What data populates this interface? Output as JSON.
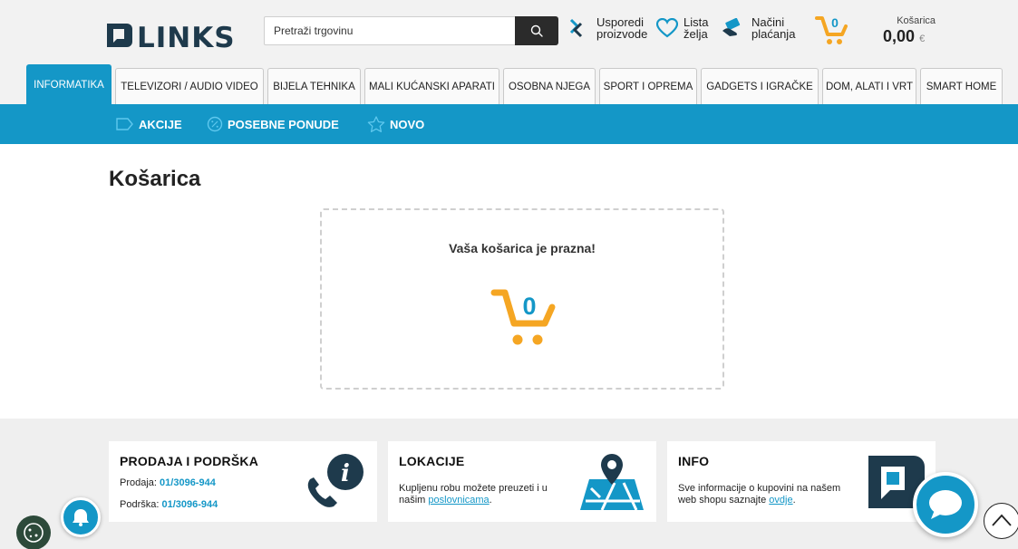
{
  "header": {
    "logo_text": "LINKS",
    "search": {
      "placeholder": "Pretraži trgovinu",
      "value": ""
    },
    "compare": {
      "line1": "Usporedi",
      "line2": "proizvode"
    },
    "wishlist": {
      "line1": "Lista",
      "line2": "želja"
    },
    "payments": {
      "line1": "Načini",
      "line2": "plaćanja"
    },
    "cart_count": "0",
    "cart_label": "Košarica",
    "cart_amount": "0,00",
    "cart_currency": "€"
  },
  "categories": [
    "INFORMATIKA",
    "TELEVIZORI / AUDIO VIDEO",
    "BIJELA TEHNIKA",
    "MALI KUĆANSKI APARATI",
    "OSOBNA NJEGA",
    "SPORT I OPREMA",
    "GADGETS I IGRAČKE",
    "DOM, ALATI I VRT",
    "SMART HOME"
  ],
  "promo_bar": {
    "akcije": "AKCIJE",
    "posebne": "POSEBNE PONUDE",
    "novo": "NOVO"
  },
  "main": {
    "title": "Košarica",
    "empty_message": "Vaša košarica je prazna!",
    "cart_count": "0"
  },
  "footer": {
    "sales": {
      "title": "PRODAJA I PODRŠKA",
      "sales_label": "Prodaja:",
      "sales_phone": "01/3096-944",
      "support_label": "Podrška:",
      "support_phone": "01/3096-944"
    },
    "locations": {
      "title": "LOKACIJE",
      "line1": "Kupljenu robu možete preuzeti i u",
      "line2_pre": "našim",
      "line2_link": "poslovnicama",
      "line2_post": "."
    },
    "info": {
      "title": "INFO",
      "line1": "Sve informacije o kupovini na našem",
      "line2_pre": "web shopu saznajte",
      "line2_link": "ovdje",
      "line2_post": "."
    }
  },
  "colors": {
    "brand_blue": "#1497c7",
    "cart_orange": "#f5a623",
    "dark": "#2b2b2b"
  }
}
